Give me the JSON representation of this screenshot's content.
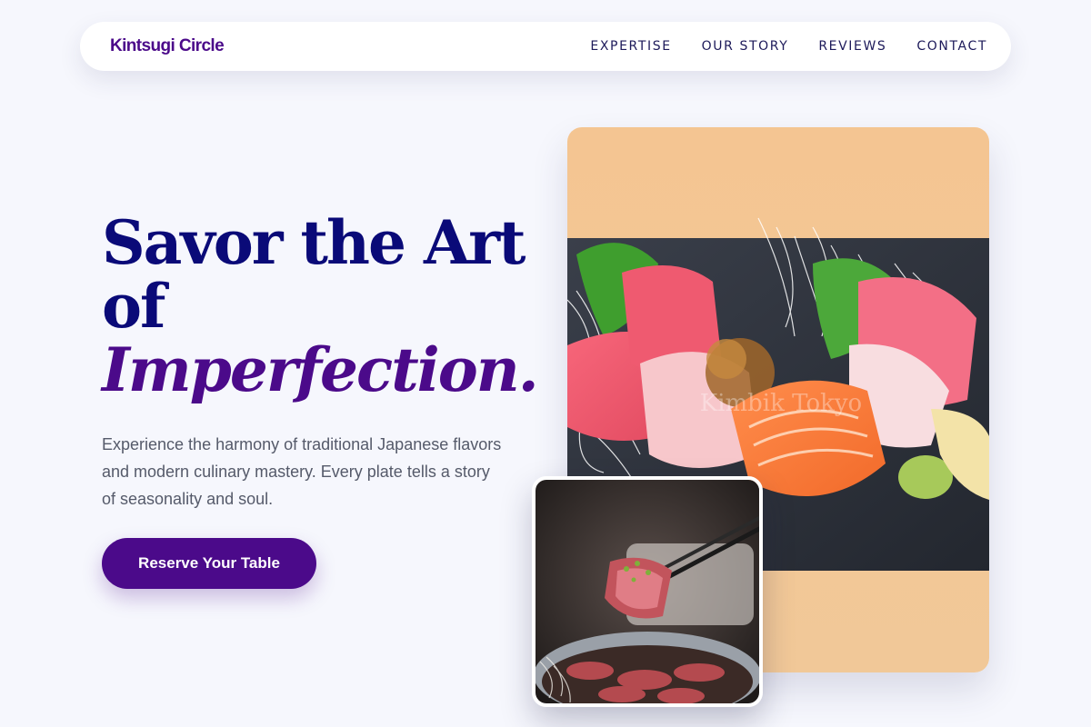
{
  "brand": {
    "name": "Kintsugi Circle"
  },
  "nav": {
    "links": [
      {
        "label": "EXPERTISE"
      },
      {
        "label": "OUR STORY"
      },
      {
        "label": "REVIEWS"
      },
      {
        "label": "CONTACT"
      }
    ]
  },
  "hero": {
    "title_line1": "Savor the Art",
    "title_line2": "of",
    "title_accent": "Imperfection.",
    "description": "Experience the harmony of traditional Japanese flavors and modern culinary mastery. Every plate tells a story of seasonality and soul.",
    "cta_label": "Reserve Your Table"
  },
  "images": {
    "main": {
      "watermark": "Kimbik Tokyo"
    }
  },
  "colors": {
    "background": "#f6f7fd",
    "brand": "#4b0a8a",
    "heading": "#0a0a78",
    "body_text": "#555a6a",
    "nav_text": "#1d1a5a"
  }
}
